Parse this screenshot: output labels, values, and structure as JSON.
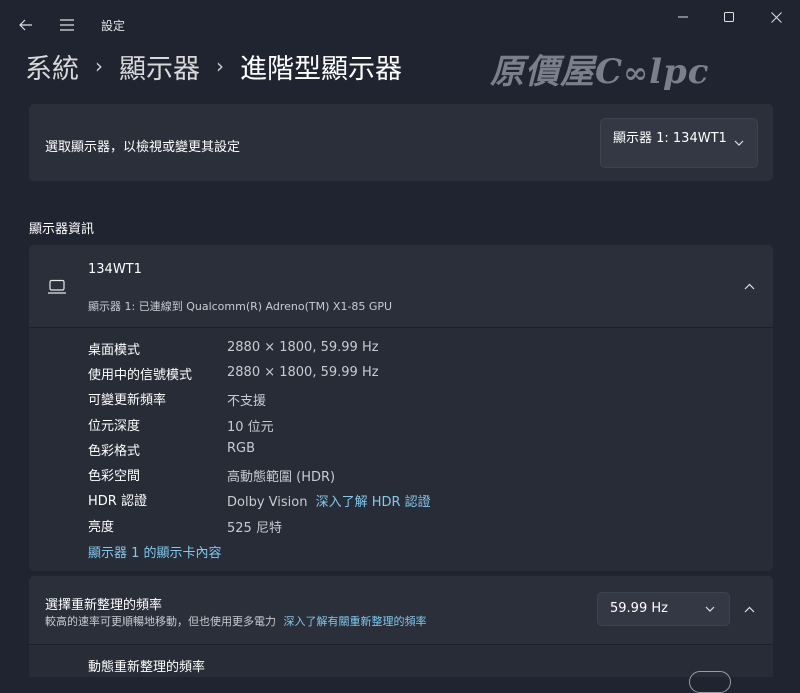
{
  "window": {
    "title": "設定"
  },
  "breadcrumb": {
    "items": [
      "系統",
      "顯示器",
      "進階型顯示器"
    ],
    "separator": "›"
  },
  "watermark": "原價屋Coolpc",
  "select_display": {
    "label": "選取顯示器，以檢視或變更其設定",
    "selected": "顯示器 1: 134WT1"
  },
  "display_info": {
    "section_title": "顯示器資訊",
    "monitor_name": "134WT1",
    "monitor_desc": "顯示器 1: 已連線到 Qualcomm(R) Adreno(TM) X1-85 GPU",
    "rows": [
      {
        "label": "桌面模式",
        "value": "2880 × 1800, 59.99 Hz"
      },
      {
        "label": "使用中的信號模式",
        "value": "2880 × 1800, 59.99 Hz"
      },
      {
        "label": "可變更新頻率",
        "value": "不支援"
      },
      {
        "label": "位元深度",
        "value": "10 位元"
      },
      {
        "label": "色彩格式",
        "value": "RGB"
      },
      {
        "label": "色彩空間",
        "value": "高動態範圍 (HDR)"
      },
      {
        "label": "HDR 認證",
        "value": "Dolby Vision"
      },
      {
        "label": "亮度",
        "value": "525 尼特"
      }
    ],
    "hdr_link": "深入了解 HDR 認證",
    "adapter_link": "顯示器 1 的顯示卡內容"
  },
  "refresh_rate": {
    "title": "選擇重新整理的頻率",
    "desc": "較高的速率可更順暢地移動，但也使用更多電力",
    "link": "深入了解有關重新整理的頻率",
    "selected": "59.99 Hz",
    "dynamic_label": "動態重新整理的頻率"
  },
  "colors": {
    "background": "#202431",
    "card": "#2b2f3a",
    "accent_link": "#7ec9ee"
  }
}
